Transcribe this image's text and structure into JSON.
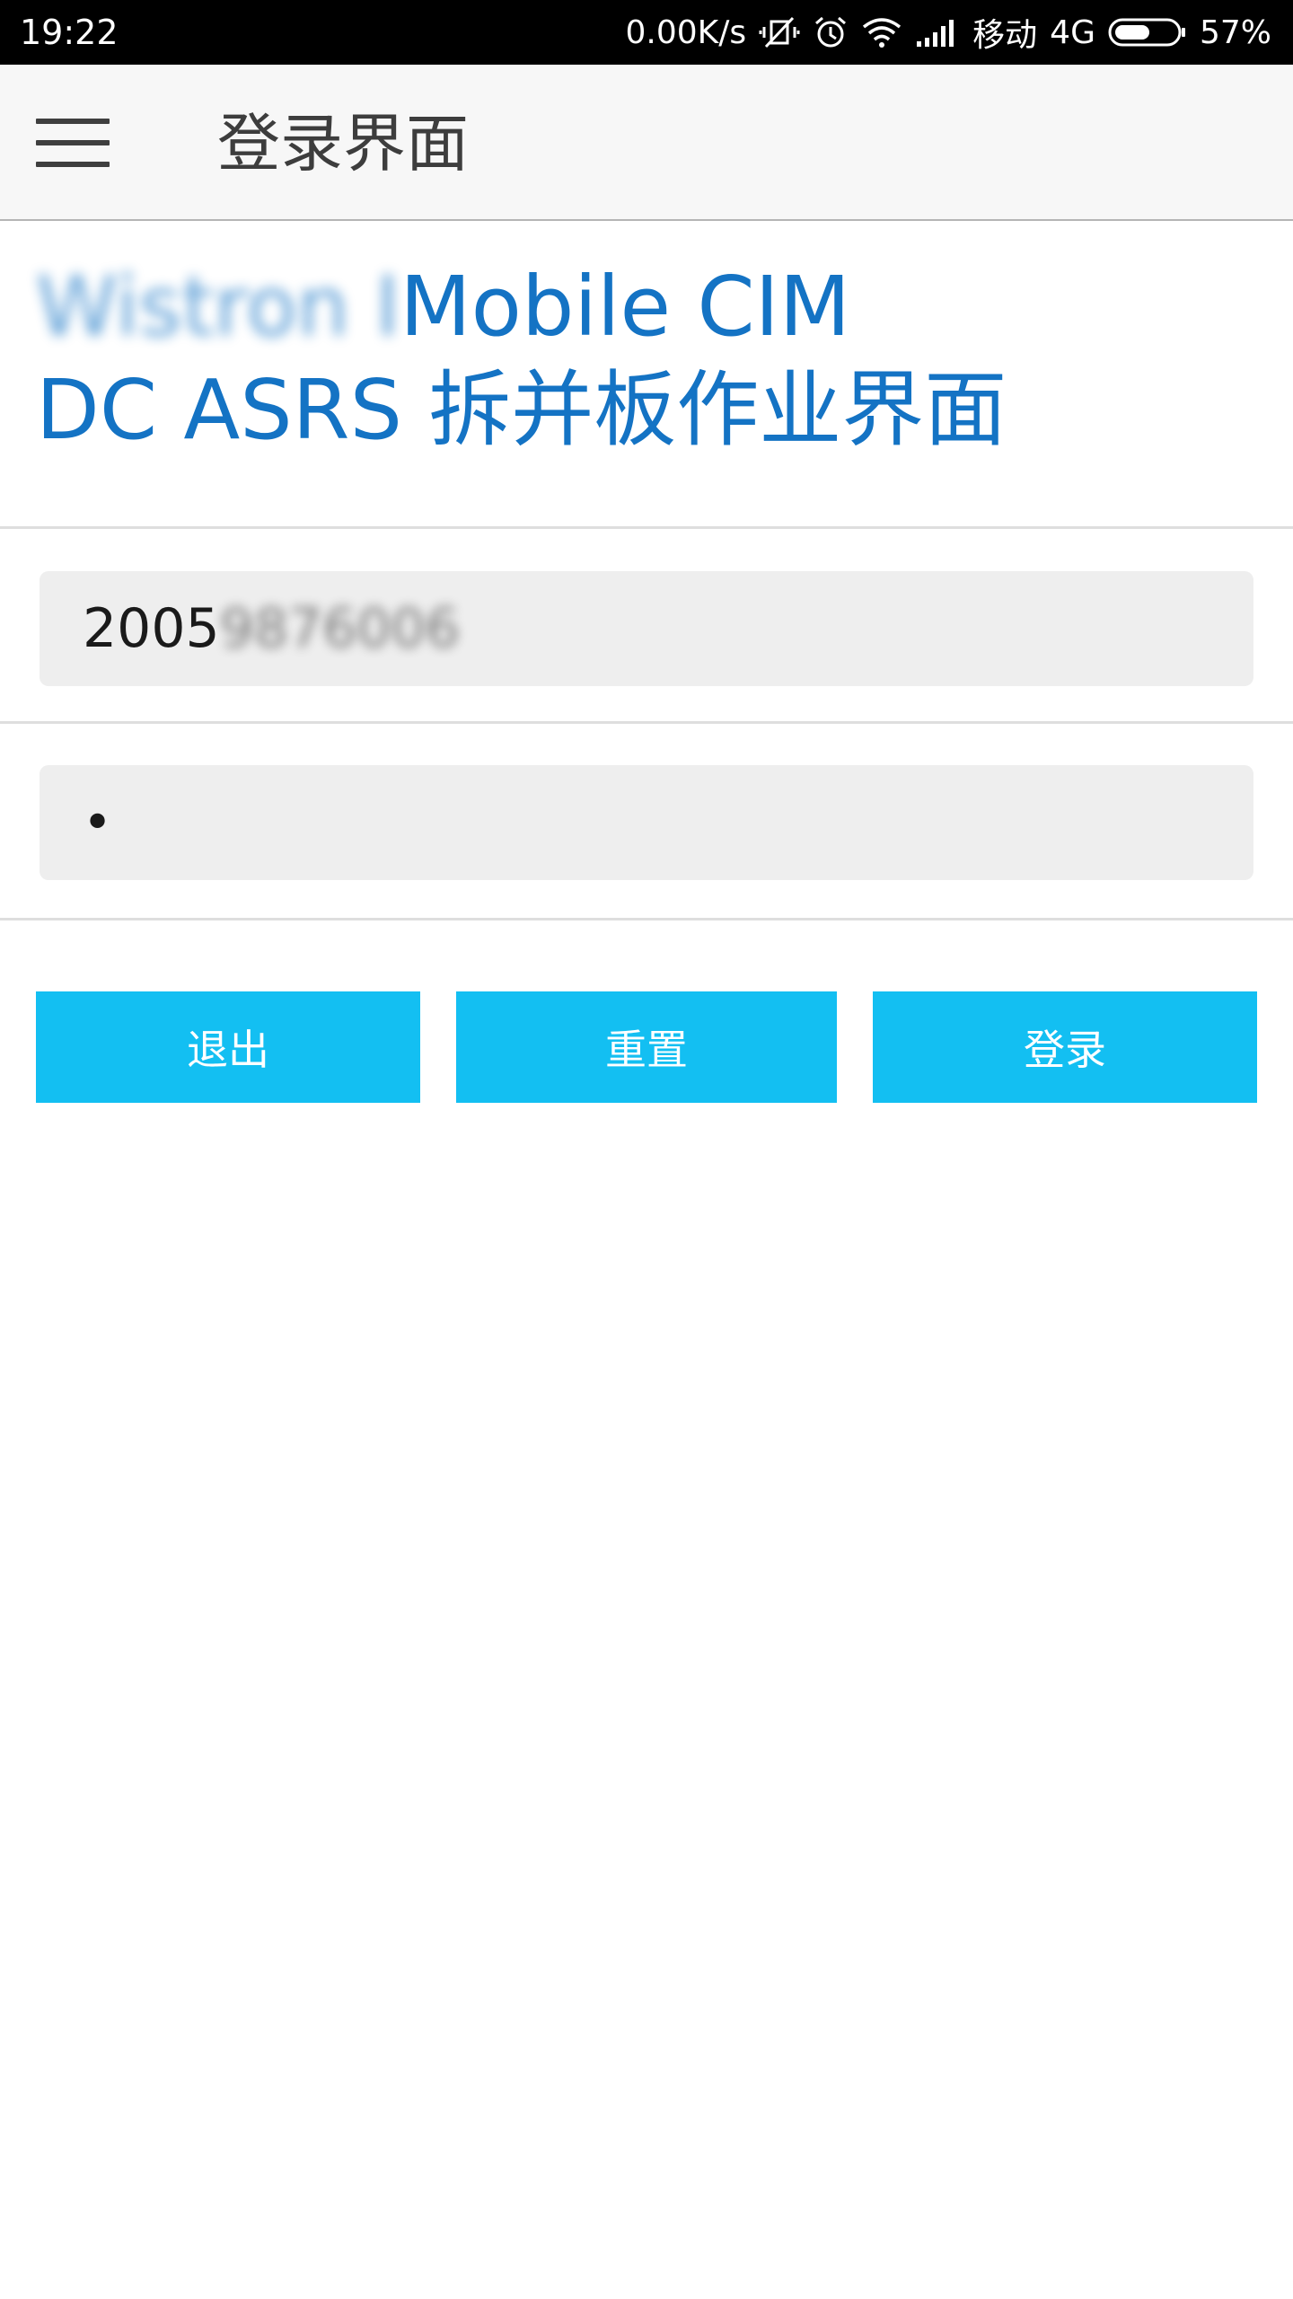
{
  "status_bar": {
    "time": "19:22",
    "network_speed": "0.00K/s",
    "carrier": "移动",
    "network_type": "4G",
    "battery_percent": "57%",
    "battery_level": 0.57
  },
  "app_bar": {
    "title": "登录界面"
  },
  "header": {
    "line1_blurred": "Wistron I",
    "line1": "Mobile CIM",
    "line2": "DC ASRS 拆并板作业界面"
  },
  "form": {
    "username_visible": "2005",
    "username_blurred": "9876006",
    "password_masked": "•"
  },
  "buttons": {
    "exit": "退出",
    "reset": "重置",
    "login": "登录"
  },
  "colors": {
    "accent": "#13bff2",
    "header_text": "#1473c4",
    "app_bar_bg": "#f7f7f7",
    "status_bar_bg": "#000000"
  }
}
